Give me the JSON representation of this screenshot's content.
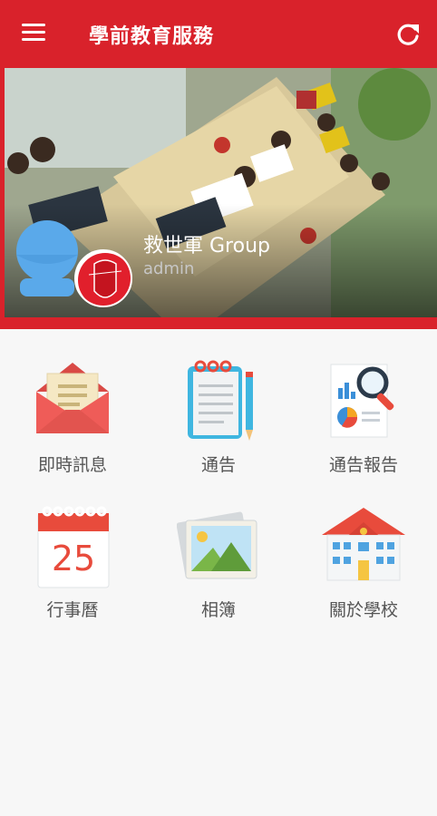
{
  "app_bar": {
    "title": "學前教育服務",
    "menu_icon": "hamburger-menu-icon",
    "refresh_icon": "refresh-icon",
    "background": "#d9222b"
  },
  "profile": {
    "group_name": "救世軍 Group",
    "role": "admin",
    "logo_text": "救世軍"
  },
  "menu_tiles": [
    {
      "label": "即時訊息",
      "icon": "envelope-icon"
    },
    {
      "label": "通告",
      "icon": "notepad-icon"
    },
    {
      "label": "通告報告",
      "icon": "report-chart-icon"
    },
    {
      "label": "行事曆",
      "icon": "calendar-icon",
      "calendar_day": "25"
    },
    {
      "label": "相簿",
      "icon": "photo-album-icon"
    },
    {
      "label": "關於學校",
      "icon": "school-building-icon"
    }
  ]
}
